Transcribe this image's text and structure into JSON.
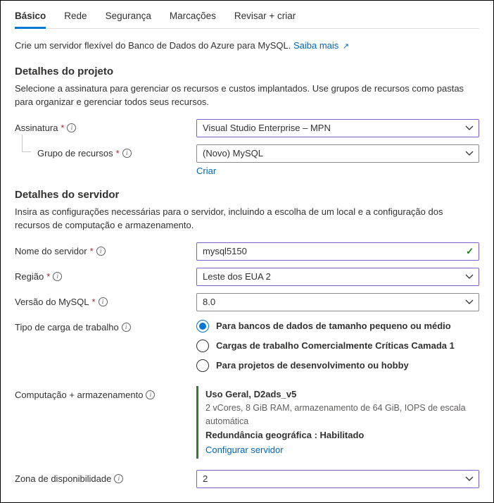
{
  "tabs": {
    "basic": "Básico",
    "network": "Rede",
    "security": "Segurança",
    "tags": "Marcações",
    "review": "Revisar + criar"
  },
  "intro_text": "Crie um servidor flexível do Banco de Dados do Azure para MySQL.",
  "learn_more": "Saiba mais",
  "project": {
    "heading": "Detalhes do projeto",
    "desc": "Selecione a assinatura para gerenciar os recursos e custos implantados. Use grupos de recursos como pastas para organizar e gerenciar todos seus recursos.",
    "subscription_label": "Assinatura",
    "subscription_value": "Visual Studio Enterprise – MPN",
    "rg_label": "Grupo de recursos",
    "rg_value": "(Novo) MySQL",
    "rg_create": "Criar"
  },
  "server": {
    "heading": "Detalhes do servidor",
    "desc": "Insira as configurações necessárias para o servidor, incluindo a escolha de um local e a configuração dos recursos de computação e armazenamento.",
    "name_label": "Nome do servidor",
    "name_value": "mysql5150",
    "region_label": "Região",
    "region_value": "Leste dos EUA 2",
    "version_label": "Versão do MySQL",
    "version_value": "8.0",
    "workload_label": "Tipo de carga de trabalho",
    "workload_options": {
      "small": "Para bancos de dados de tamanho pequeno ou médio",
      "critical": "Cargas de trabalho Comercialmente Críticas Camada 1",
      "dev": "Para projetos de desenvolvimento ou hobby"
    },
    "compute_label": "Computação + armazenamento",
    "compute_sku": "Uso Geral, D2ads_v5",
    "compute_detail": "2 vCores, 8 GiB RAM, armazenamento de 64 GiB, IOPS de escala automática",
    "compute_redundancy": "Redundância geográfica : Habilitado",
    "compute_configure": "Configurar servidor",
    "az_label": "Zona de disponibilidade",
    "az_value": "2"
  }
}
